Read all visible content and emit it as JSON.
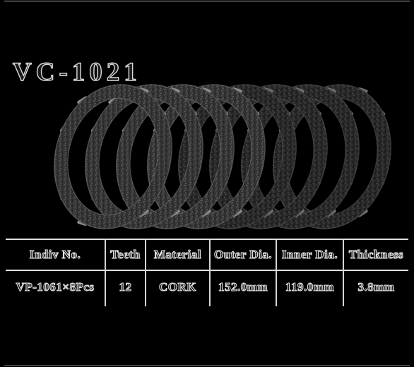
{
  "product": {
    "title": "VC-1021",
    "photo_alt": "clutch-friction-plate-stack"
  },
  "table": {
    "headers": [
      "Indiv No.",
      "Teeth",
      "Material",
      "Outer Dia.",
      "Inner Dia.",
      "Thickness"
    ],
    "rows": [
      [
        "VP-1061×8Pcs",
        "12",
        "CORK",
        "152.0mm",
        "119.0mm",
        "3.8mm"
      ]
    ]
  },
  "colors": {
    "background": "#000000",
    "rule": "#e0e0e0",
    "text_fill": "#1a1a1a",
    "text_outline": "#e0e0e0",
    "plate_body": "#3a3a3a",
    "plate_highlight": "#9c9c9c"
  }
}
